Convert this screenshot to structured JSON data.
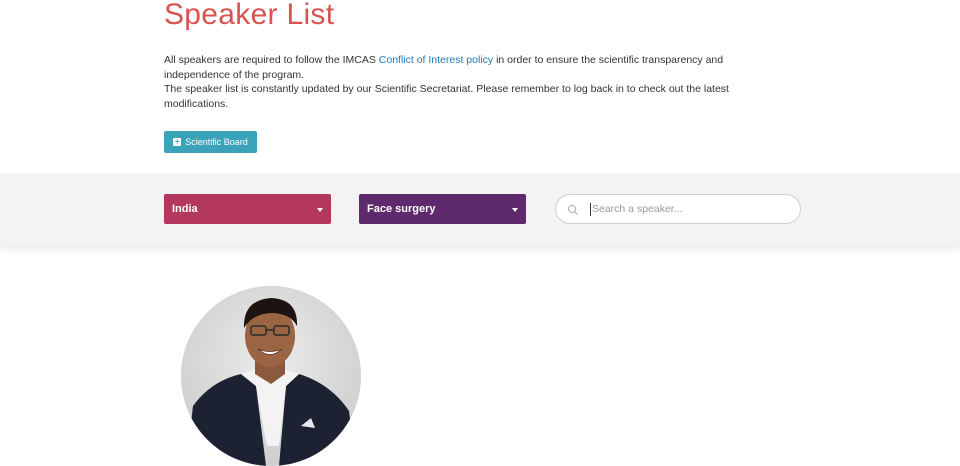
{
  "page": {
    "title": "Speaker List"
  },
  "intro": {
    "line1_before": "All speakers are required to follow the IMCAS ",
    "line1_link": "Conflict of Interest policy",
    "line1_after": " in order to ensure the scientific transparency and independence of the program.",
    "line2": "The speaker list is constantly updated by our Scientific Secretariat. Please remember to log back in to check out the latest modifications."
  },
  "board_button": {
    "label": "Scientific Board",
    "icon": "plus-square-icon"
  },
  "filters": {
    "country": "India",
    "specialty": "Face surgery",
    "country_color": "#b4385e",
    "specialty_color": "#5e2a6d"
  },
  "search": {
    "value": "",
    "placeholder": "Search a speaker..."
  },
  "colors": {
    "title": "#d9534f",
    "link": "#1f7ab8",
    "button": "#3ba3b9"
  }
}
